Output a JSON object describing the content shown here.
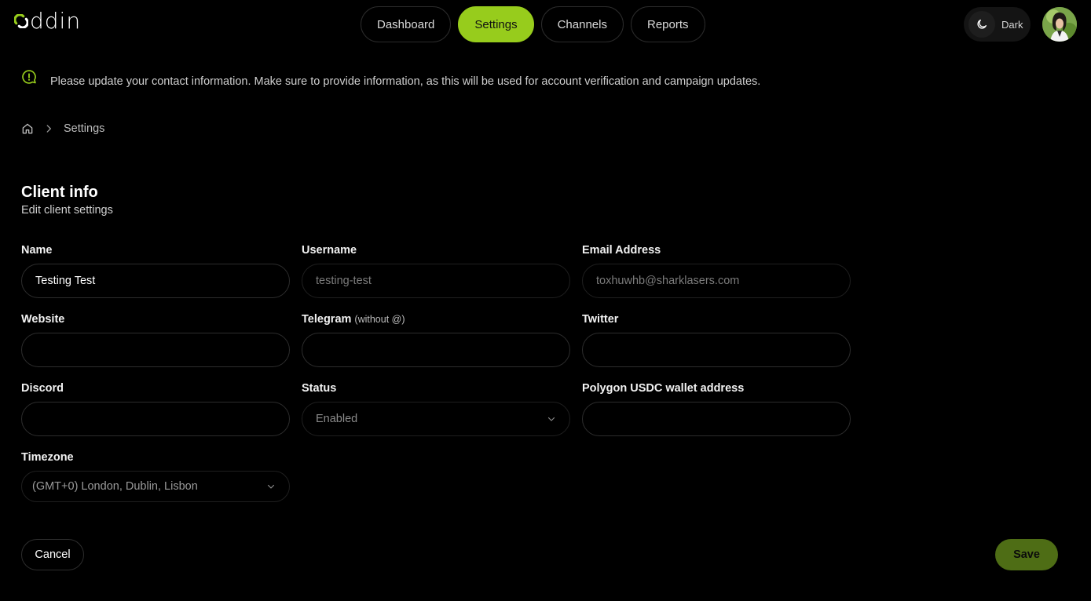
{
  "brand": {
    "logo_text": "ddin",
    "accent_color": "#97cc1c",
    "save_color": "#4e6d15"
  },
  "nav": {
    "tabs": [
      {
        "label": "Dashboard",
        "active": false
      },
      {
        "label": "Settings",
        "active": true
      },
      {
        "label": "Channels",
        "active": false
      },
      {
        "label": "Reports",
        "active": false
      }
    ]
  },
  "header": {
    "theme_label": "Dark",
    "theme_icon": "moon-icon",
    "avatar_icon": "user-avatar"
  },
  "notice": {
    "icon": "alert-bubble-icon",
    "text": "Please update your contact information. Make sure to provide information, as this will be used for account verification and campaign updates."
  },
  "breadcrumb": {
    "home_icon": "home-icon",
    "separator_icon": "chevron-right-icon",
    "current": "Settings"
  },
  "section": {
    "title": "Client info",
    "subtitle": "Edit client settings"
  },
  "form": {
    "name": {
      "label": "Name",
      "value": "Testing Test"
    },
    "username": {
      "label": "Username",
      "value": "testing-test"
    },
    "email": {
      "label": "Email Address",
      "value": "toxhuwhb@sharklasers.com"
    },
    "website": {
      "label": "Website",
      "value": ""
    },
    "telegram": {
      "label": "Telegram",
      "hint": "(without @)",
      "value": ""
    },
    "twitter": {
      "label": "Twitter",
      "value": ""
    },
    "discord": {
      "label": "Discord",
      "value": ""
    },
    "status": {
      "label": "Status",
      "value": "Enabled"
    },
    "wallet": {
      "label": "Polygon USDC wallet address",
      "value": ""
    },
    "timezone": {
      "label": "Timezone",
      "value": "(GMT+0) London, Dublin, Lisbon"
    }
  },
  "actions": {
    "cancel_label": "Cancel",
    "save_label": "Save"
  }
}
